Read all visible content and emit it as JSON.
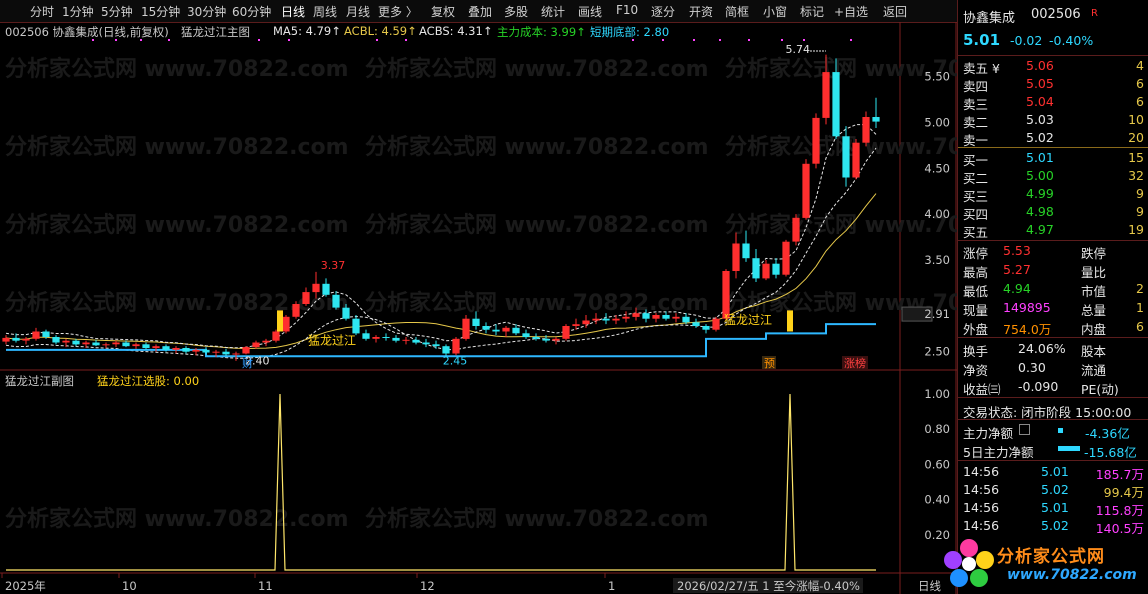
{
  "toolbar": {
    "left_items": [
      "分时",
      "1分钟",
      "5分钟",
      "15分钟",
      "30分钟",
      "60分钟",
      "日线",
      "周线",
      "月线",
      "更多 〉"
    ],
    "active": "日线",
    "right_items": [
      "复权",
      "叠加",
      "多股",
      "统计",
      "画线",
      "F10",
      "逐分",
      "开资",
      "简框",
      "小窗",
      "标记",
      "+自选",
      "返回"
    ]
  },
  "main_info": {
    "stock": "002506 协鑫集成(日线,前复权)",
    "formula": "猛龙过江主图",
    "ma5": "MA5: 4.79↑",
    "acbl": "ACBL: 4.59↑",
    "acbs": "ACBS: 4.31↑",
    "main_cost": "主力成本: 3.99↑",
    "short_bottom": "短期底部: 2.80"
  },
  "sub_info": {
    "formula": "猛龙过江副图",
    "signal": "猛龙过江选股: 0.00"
  },
  "watermark": "分析家公式网 www.70822.com",
  "chart_data": {
    "type": "candlestick",
    "main_yticks": [
      "5.50",
      "5.00",
      "4.50",
      "4.00",
      "3.50",
      "2.91",
      "2.50"
    ],
    "sub_yticks": [
      "1.00",
      "0.80",
      "0.60",
      "0.40",
      "0.20"
    ],
    "xticks": [
      "2025年",
      "10",
      "11",
      "12",
      "1"
    ],
    "bottom_status": "2026/02/27/五 1 至今涨幅-0.40%",
    "period_label": "日线",
    "annotations": {
      "high_574": "5.74",
      "high_337": "3.37",
      "low_240": "2.40",
      "low_245": "2.45",
      "signal_1": "猛龙过江",
      "signal_2": "猛龙过江",
      "tag_cai": "财",
      "tag_yu": "预",
      "tag_zhangbang": "涨榜"
    },
    "ohlc": [
      [
        2.61,
        2.68,
        2.58,
        2.65
      ],
      [
        2.65,
        2.7,
        2.6,
        2.62
      ],
      [
        2.62,
        2.66,
        2.58,
        2.64
      ],
      [
        2.64,
        2.76,
        2.62,
        2.72
      ],
      [
        2.72,
        2.74,
        2.64,
        2.66
      ],
      [
        2.66,
        2.68,
        2.58,
        2.6
      ],
      [
        2.6,
        2.64,
        2.55,
        2.62
      ],
      [
        2.62,
        2.64,
        2.56,
        2.58
      ],
      [
        2.58,
        2.62,
        2.54,
        2.6
      ],
      [
        2.6,
        2.63,
        2.56,
        2.57
      ],
      [
        2.57,
        2.6,
        2.54,
        2.58
      ],
      [
        2.58,
        2.62,
        2.55,
        2.6
      ],
      [
        2.6,
        2.62,
        2.55,
        2.56
      ],
      [
        2.56,
        2.6,
        2.53,
        2.58
      ],
      [
        2.58,
        2.6,
        2.52,
        2.54
      ],
      [
        2.54,
        2.58,
        2.5,
        2.56
      ],
      [
        2.56,
        2.58,
        2.5,
        2.52
      ],
      [
        2.52,
        2.56,
        2.48,
        2.54
      ],
      [
        2.54,
        2.56,
        2.48,
        2.5
      ],
      [
        2.5,
        2.54,
        2.46,
        2.52
      ],
      [
        2.52,
        2.55,
        2.47,
        2.49
      ],
      [
        2.49,
        2.52,
        2.44,
        2.5
      ],
      [
        2.5,
        2.53,
        2.45,
        2.47
      ],
      [
        2.47,
        2.5,
        2.4,
        2.48
      ],
      [
        2.48,
        2.56,
        2.47,
        2.55
      ],
      [
        2.55,
        2.62,
        2.53,
        2.6
      ],
      [
        2.6,
        2.64,
        2.56,
        2.62
      ],
      [
        2.62,
        2.74,
        2.6,
        2.72
      ],
      [
        2.72,
        2.9,
        2.7,
        2.88
      ],
      [
        2.88,
        3.05,
        2.86,
        3.02
      ],
      [
        3.02,
        3.2,
        3.0,
        3.15
      ],
      [
        3.15,
        3.37,
        3.08,
        3.24
      ],
      [
        3.24,
        3.3,
        3.1,
        3.12
      ],
      [
        3.12,
        3.16,
        2.96,
        2.98
      ],
      [
        2.98,
        3.02,
        2.84,
        2.86
      ],
      [
        2.86,
        2.9,
        2.68,
        2.7
      ],
      [
        2.7,
        2.74,
        2.62,
        2.64
      ],
      [
        2.64,
        2.68,
        2.6,
        2.66
      ],
      [
        2.66,
        2.7,
        2.62,
        2.65
      ],
      [
        2.65,
        2.68,
        2.6,
        2.62
      ],
      [
        2.62,
        2.66,
        2.58,
        2.63
      ],
      [
        2.63,
        2.66,
        2.58,
        2.6
      ],
      [
        2.6,
        2.64,
        2.55,
        2.58
      ],
      [
        2.58,
        2.62,
        2.53,
        2.56
      ],
      [
        2.56,
        2.58,
        2.45,
        2.48
      ],
      [
        2.48,
        2.66,
        2.46,
        2.64
      ],
      [
        2.64,
        2.9,
        2.62,
        2.86
      ],
      [
        2.86,
        2.94,
        2.74,
        2.78
      ],
      [
        2.78,
        2.82,
        2.7,
        2.74
      ],
      [
        2.74,
        2.8,
        2.68,
        2.72
      ],
      [
        2.72,
        2.78,
        2.66,
        2.76
      ],
      [
        2.76,
        2.8,
        2.68,
        2.7
      ],
      [
        2.7,
        2.74,
        2.64,
        2.66
      ],
      [
        2.66,
        2.7,
        2.62,
        2.64
      ],
      [
        2.64,
        2.68,
        2.6,
        2.62
      ],
      [
        2.62,
        2.66,
        2.58,
        2.64
      ],
      [
        2.64,
        2.8,
        2.62,
        2.78
      ],
      [
        2.78,
        2.86,
        2.74,
        2.8
      ],
      [
        2.8,
        2.9,
        2.76,
        2.84
      ],
      [
        2.84,
        2.92,
        2.8,
        2.86
      ],
      [
        2.86,
        2.92,
        2.8,
        2.84
      ],
      [
        2.84,
        2.9,
        2.8,
        2.86
      ],
      [
        2.86,
        2.94,
        2.82,
        2.88
      ],
      [
        2.88,
        2.98,
        2.84,
        2.92
      ],
      [
        2.92,
        2.96,
        2.82,
        2.86
      ],
      [
        2.86,
        2.92,
        2.82,
        2.9
      ],
      [
        2.9,
        2.94,
        2.84,
        2.86
      ],
      [
        2.86,
        2.92,
        2.82,
        2.88
      ],
      [
        2.88,
        2.92,
        2.8,
        2.82
      ],
      [
        2.82,
        2.86,
        2.76,
        2.78
      ],
      [
        2.78,
        2.8,
        2.7,
        2.74
      ],
      [
        2.74,
        2.88,
        2.72,
        2.86
      ],
      [
        2.86,
        3.4,
        2.84,
        3.38
      ],
      [
        3.38,
        3.8,
        3.3,
        3.68
      ],
      [
        3.68,
        3.82,
        3.48,
        3.52
      ],
      [
        3.52,
        3.62,
        3.26,
        3.3
      ],
      [
        3.3,
        3.5,
        3.28,
        3.46
      ],
      [
        3.46,
        3.52,
        3.3,
        3.34
      ],
      [
        3.34,
        3.72,
        3.32,
        3.7
      ],
      [
        3.7,
        4.0,
        3.66,
        3.96
      ],
      [
        3.96,
        4.6,
        3.94,
        4.55
      ],
      [
        4.55,
        5.1,
        4.5,
        5.05
      ],
      [
        5.05,
        5.74,
        4.98,
        5.55
      ],
      [
        5.55,
        5.7,
        4.82,
        4.85
      ],
      [
        4.85,
        4.96,
        4.3,
        4.4
      ],
      [
        4.4,
        4.82,
        4.38,
        4.78
      ],
      [
        4.78,
        5.12,
        4.74,
        5.06
      ],
      [
        5.06,
        5.27,
        4.94,
        5.01
      ]
    ],
    "short_bottom": [
      2.52,
      2.52,
      2.52,
      2.52,
      2.52,
      2.52,
      2.52,
      2.52,
      2.52,
      2.52,
      2.52,
      2.52,
      2.52,
      2.52,
      2.52,
      2.52,
      2.52,
      2.52,
      2.52,
      2.52,
      2.45,
      2.45,
      2.45,
      2.45,
      2.45,
      2.45,
      2.45,
      2.45,
      2.45,
      2.45,
      2.45,
      2.45,
      2.45,
      2.45,
      2.45,
      2.45,
      2.45,
      2.45,
      2.45,
      2.45,
      2.45,
      2.45,
      2.45,
      2.45,
      2.45,
      2.45,
      2.45,
      2.45,
      2.45,
      2.45,
      2.45,
      2.45,
      2.45,
      2.45,
      2.45,
      2.45,
      2.45,
      2.45,
      2.45,
      2.45,
      2.45,
      2.45,
      2.45,
      2.45,
      2.45,
      2.45,
      2.45,
      2.45,
      2.45,
      2.45,
      2.64,
      2.64,
      2.64,
      2.64,
      2.64,
      2.64,
      2.7,
      2.7,
      2.7,
      2.7,
      2.7,
      2.7,
      2.8,
      2.8,
      2.8,
      2.8,
      2.8,
      2.8
    ],
    "signal_days": [
      20,
      71
    ]
  },
  "quote": {
    "name": "协鑫集成",
    "code": "002506",
    "badge": "R",
    "price": "5.01",
    "change": "-0.02",
    "pct": "-0.40%",
    "asks": [
      {
        "label": "卖五 ¥",
        "price": "5.06",
        "vol": "4"
      },
      {
        "label": "卖四",
        "price": "5.05",
        "vol": "6"
      },
      {
        "label": "卖三",
        "price": "5.04",
        "vol": "6"
      },
      {
        "label": "卖二",
        "price": "5.03",
        "vol": "10"
      },
      {
        "label": "卖一",
        "price": "5.02",
        "vol": "20"
      }
    ],
    "bids": [
      {
        "label": "买一",
        "price": "5.01",
        "vol": "15"
      },
      {
        "label": "买二",
        "price": "5.00",
        "vol": "32"
      },
      {
        "label": "买三",
        "price": "4.99",
        "vol": "9"
      },
      {
        "label": "买四",
        "price": "4.98",
        "vol": "9"
      },
      {
        "label": "买五",
        "price": "4.97",
        "vol": "19"
      }
    ],
    "stats1": [
      {
        "k": "涨停",
        "v": "5.53",
        "k2": "跌停",
        "v2": ""
      },
      {
        "k": "最高",
        "v": "5.27",
        "k2": "量比",
        "v2": ""
      },
      {
        "k": "最低",
        "v": "4.94",
        "k2": "市值",
        "v2": "2"
      },
      {
        "k": "现量",
        "v": "149895",
        "k2": "总量",
        "v2": "1"
      },
      {
        "k": "外盘",
        "v": "754.0万",
        "k2": "内盘",
        "v2": "6"
      }
    ],
    "stats2": [
      {
        "k": "换手",
        "v": "24.06%",
        "k2": "股本"
      },
      {
        "k": "净资",
        "v": "0.30",
        "k2": "流通"
      },
      {
        "k": "收益㈢",
        "v": "-0.090",
        "k2": "PE(动)"
      }
    ],
    "trade_status": "交易状态: 闭市阶段 15:00:00",
    "net_main": {
      "label": "主力净额",
      "value": "-4.36亿"
    },
    "net_main5": {
      "label": "5日主力净额",
      "value": "-15.68亿"
    },
    "ticks": [
      {
        "t": "14:56",
        "p": "5.01",
        "v": "185.7万"
      },
      {
        "t": "14:56",
        "p": "5.02",
        "v": "99.4万"
      },
      {
        "t": "14:56",
        "p": "5.01",
        "v": "115.8万"
      },
      {
        "t": "14:56",
        "p": "5.02",
        "v": "140.5万"
      }
    ]
  },
  "logo": {
    "text": "分析家公式网",
    "url": "www.70822.com"
  }
}
